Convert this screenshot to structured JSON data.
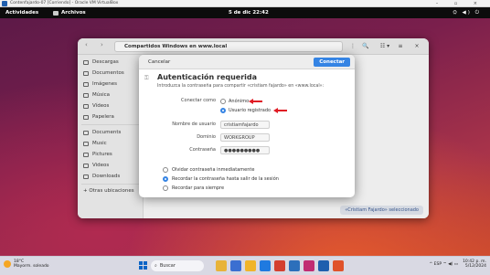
{
  "host_window": {
    "title": "Contenfajardo-07 [Corriendo] - Oracle VM VirtualBox",
    "controls": "–  ▫  ×"
  },
  "gnome_panel": {
    "activities": "Actividades",
    "app_name": "Archivos",
    "clock": "5 de dic  22:42",
    "tray": "⛭ ◀) ⏻"
  },
  "nautilus": {
    "nav": "‹ ›",
    "path": "Compartidos Windows en www.local",
    "header_buttons": [
      "⋮",
      "🔍",
      "☷ ▾",
      "≡",
      "×"
    ],
    "sidebar": {
      "top_items": [
        "Descargas",
        "Documentos",
        "Imágenes",
        "Música",
        "Vídeos",
        "Papelera"
      ],
      "bottom_items": [
        "Documents",
        "Music",
        "Pictures",
        "Videos",
        "Downloads"
      ],
      "other_locations": "+  Otras ubicaciones"
    },
    "status": "«Cristiam Fajardo» seleccionado"
  },
  "dialog": {
    "cancel_label": "Cancelar",
    "connect_label": "Conectar",
    "title": "Autenticación requerida",
    "subtitle": "Introduzca la contraseña para compartir «cristiam fajardo» en «www.local»:",
    "connect_as_label": "Conectar como",
    "radio_anonymous": "Anónimo",
    "radio_registered": "Usuario registrado",
    "username_label": "Nombre de usuario",
    "username_value": "cristiamfajardo",
    "domain_label": "Dominio",
    "domain_value": "WORKGROUP",
    "password_label": "Contraseña",
    "password_value": "●●●●●●●●●",
    "options": [
      "Olvidar contraseña inmediatamente",
      "Recordar la contraseña hasta salir de la sesión",
      "Recordar para siempre"
    ],
    "selected_option_index": 1,
    "selected_radio": "Usuario registrado"
  },
  "taskbar": {
    "weather_temp": "18°C",
    "weather_desc": "Mayorm. soleado",
    "search_label": "Buscar",
    "tray_icons": "^  ESP  ⌔ ◀) ▭",
    "lang": "ES",
    "time": "10:42 p. m.",
    "date": "5/12/2024"
  },
  "colors": {
    "accent": "#3584e4",
    "annotation_arrow": "#e01b24",
    "wallpaper_top": "#5d1a48",
    "wallpaper_bottom": "#c4452f"
  }
}
